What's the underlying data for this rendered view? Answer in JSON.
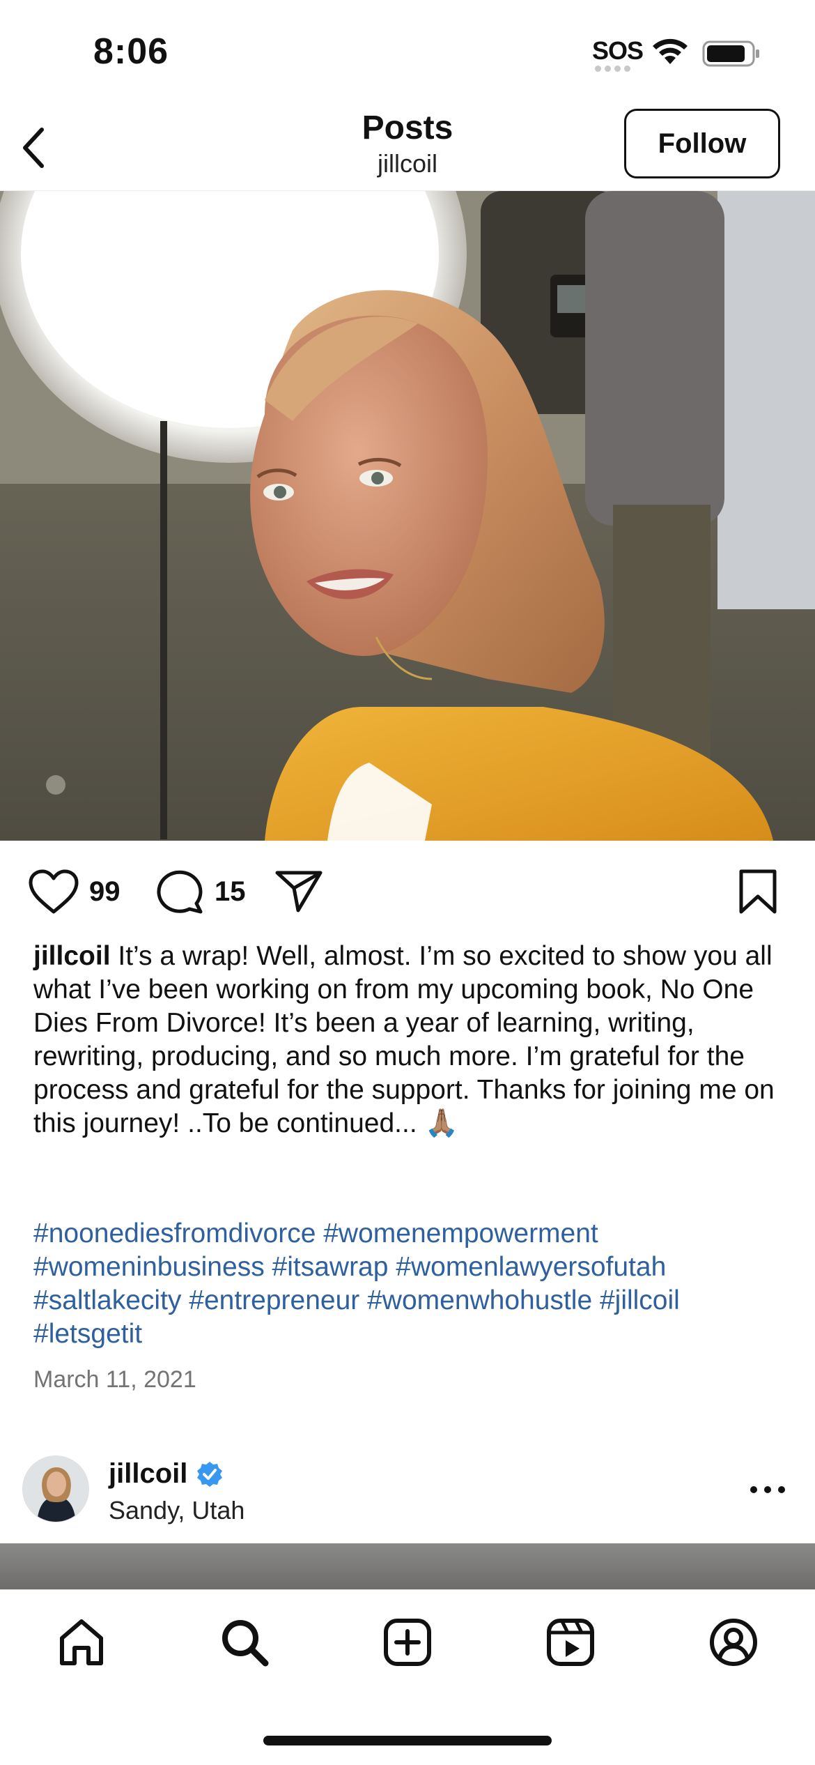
{
  "status_bar": {
    "time": "8:06",
    "sos": "SOS"
  },
  "header": {
    "title": "Posts",
    "subtitle": "jillcoil",
    "follow_label": "Follow"
  },
  "post": {
    "likes": "99",
    "comments": "15",
    "caption_user": "jillcoil",
    "caption_text": "It’s a wrap! Well, almost. I’m so excited to show you all what I’ve been working on from my upcoming book, No One Dies From Divorce! It’s been a year of learning, writing, rewriting, producing, and so much more. I’m grateful for the process and grateful for the support. Thanks for joining me on this journey! ..To be continued... 🙏🏽",
    "hashtags": "#noonediesfromdivorce #womenempowerment #womeninbusiness #itsawrap #womenlawyersofutah #saltlakecity #entrepreneur #womenwhohustle #jillcoil #letsgetit",
    "date": "March 11, 2021"
  },
  "next_post": {
    "username": "jillcoil",
    "location": "Sandy, Utah"
  },
  "tab_bar": {
    "items": [
      "home-icon",
      "search-icon",
      "create-icon",
      "reels-icon",
      "profile-icon"
    ]
  },
  "colors": {
    "hashtag": "#2e5f9f",
    "verified": "#3897f0",
    "blazer": "#e8a42a"
  }
}
